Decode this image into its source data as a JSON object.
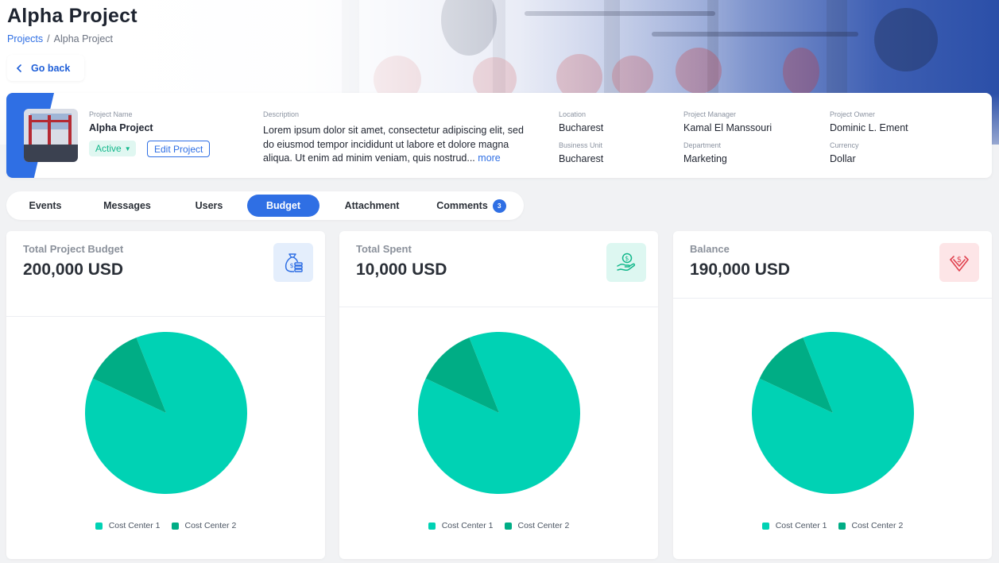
{
  "page": {
    "title": "Alpha Project",
    "breadcrumb": [
      "Projects",
      "/",
      "Alpha Project"
    ],
    "go_back_label": "Go back"
  },
  "project": {
    "name_label": "Project Name",
    "name": "Alpha Project",
    "status": "Active",
    "edit_label": "Edit Project",
    "description_label": "Description",
    "description": "Lorem ipsum dolor sit amet, consectetur adipiscing elit, sed do eiusmod tempor incididunt ut labore et dolore magna aliqua. Ut enim ad minim veniam, quis nostrud...",
    "more_label": "more",
    "location_label": "Location",
    "location": "Bucharest",
    "business_unit_label": "Business Unit",
    "business_unit": "Bucharest",
    "manager_label": "Project Manager",
    "manager": "Kamal El Manssouri",
    "department_label": "Department",
    "department": "Marketing",
    "owner_label": "Project Owner",
    "owner": "Dominic L. Ement",
    "currency_label": "Currency",
    "currency": "Dollar"
  },
  "tabs": [
    {
      "label": "Events",
      "active": false
    },
    {
      "label": "Messages",
      "active": false
    },
    {
      "label": "Users",
      "active": false
    },
    {
      "label": "Budget",
      "active": true
    },
    {
      "label": "Attachment",
      "active": false
    },
    {
      "label": "Comments",
      "active": false,
      "badge": "3"
    }
  ],
  "colors": {
    "primary": "#2f6fe4",
    "cost_center_1": "#00d2b4",
    "cost_center_2": "#00ad85",
    "icon_blue_bg": "#e4eefc",
    "icon_green_bg": "#ddf7f1",
    "icon_red_bg": "#fde5e7"
  },
  "cards": [
    {
      "label": "Total Project Budget",
      "value": "200,000 USD",
      "icon": "money-bag-icon",
      "color": "#2f6fe4"
    },
    {
      "label": "Total Spent",
      "value": "10,000 USD",
      "icon": "hand-coin-icon",
      "color": "#14b88c"
    },
    {
      "label": "Balance",
      "value": "190,000 USD",
      "icon": "diamond-dollar-icon",
      "color": "#e0424f"
    }
  ],
  "chart_data": [
    {
      "type": "pie",
      "categories": [
        "Cost Center 1",
        "Cost Center 2"
      ],
      "values": [
        88,
        12
      ]
    },
    {
      "type": "pie",
      "categories": [
        "Cost Center 1",
        "Cost Center 2"
      ],
      "values": [
        88,
        12
      ]
    },
    {
      "type": "pie",
      "categories": [
        "Cost Center 1",
        "Cost Center 2"
      ],
      "values": [
        88,
        12
      ]
    }
  ]
}
